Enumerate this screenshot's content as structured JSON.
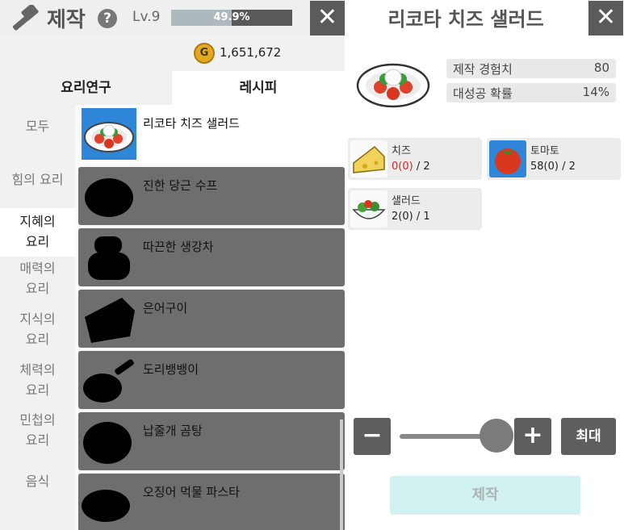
{
  "left": {
    "title": "제작",
    "help_symbol": "?",
    "level": "Lv.9",
    "xp_percent": 49.9,
    "xp_text": "49.9%",
    "close_symbol": "✕",
    "gold_symbol": "G",
    "gold_amount": "1,651,672",
    "tabs": [
      "요리연구",
      "레시피"
    ],
    "categories": [
      "모두",
      "힘의 요리",
      "지혜의\n요리",
      "매력의\n요리",
      "지식의\n요리",
      "체력의\n요리",
      "민첩의\n요리",
      "음식"
    ],
    "recipes": [
      {
        "name": "리코타 치즈 샐러드",
        "icon": "salad-plate-icon"
      },
      {
        "name": "진한 당근 수프",
        "icon": "soup-silhouette-icon"
      },
      {
        "name": "따끈한 생강차",
        "icon": "teacup-silhouette-icon"
      },
      {
        "name": "은어구이",
        "icon": "grilled-fish-silhouette-icon"
      },
      {
        "name": "도리뱅뱅이",
        "icon": "frying-pan-silhouette-icon"
      },
      {
        "name": "납줄개 곰탕",
        "icon": "bowl-silhouette-icon"
      },
      {
        "name": "오징어 먹물 파스타",
        "icon": "pasta-silhouette-icon"
      }
    ]
  },
  "right": {
    "title": "리코타 치즈 샐러드",
    "close_symbol": "✕",
    "stats": [
      {
        "label": "제작 경험치",
        "value": "80"
      },
      {
        "label": "대성공 확률",
        "value": "14%"
      }
    ],
    "ingredients": [
      {
        "name": "치즈",
        "have": "0(0)",
        "need": " / 2",
        "insufficient": true,
        "icon": "cheese-icon"
      },
      {
        "name": "토마토",
        "have": "58(0)",
        "need": " / 2",
        "insufficient": false,
        "icon": "tomato-icon"
      },
      {
        "name": "샐러드",
        "have": "2(0)",
        "need": " / 1",
        "insufficient": false,
        "icon": "salad-bowl-icon"
      }
    ],
    "minus_symbol": "−",
    "plus_symbol": "+",
    "max_label": "최대",
    "craft_label": "제작",
    "slider_level": 1.0
  }
}
